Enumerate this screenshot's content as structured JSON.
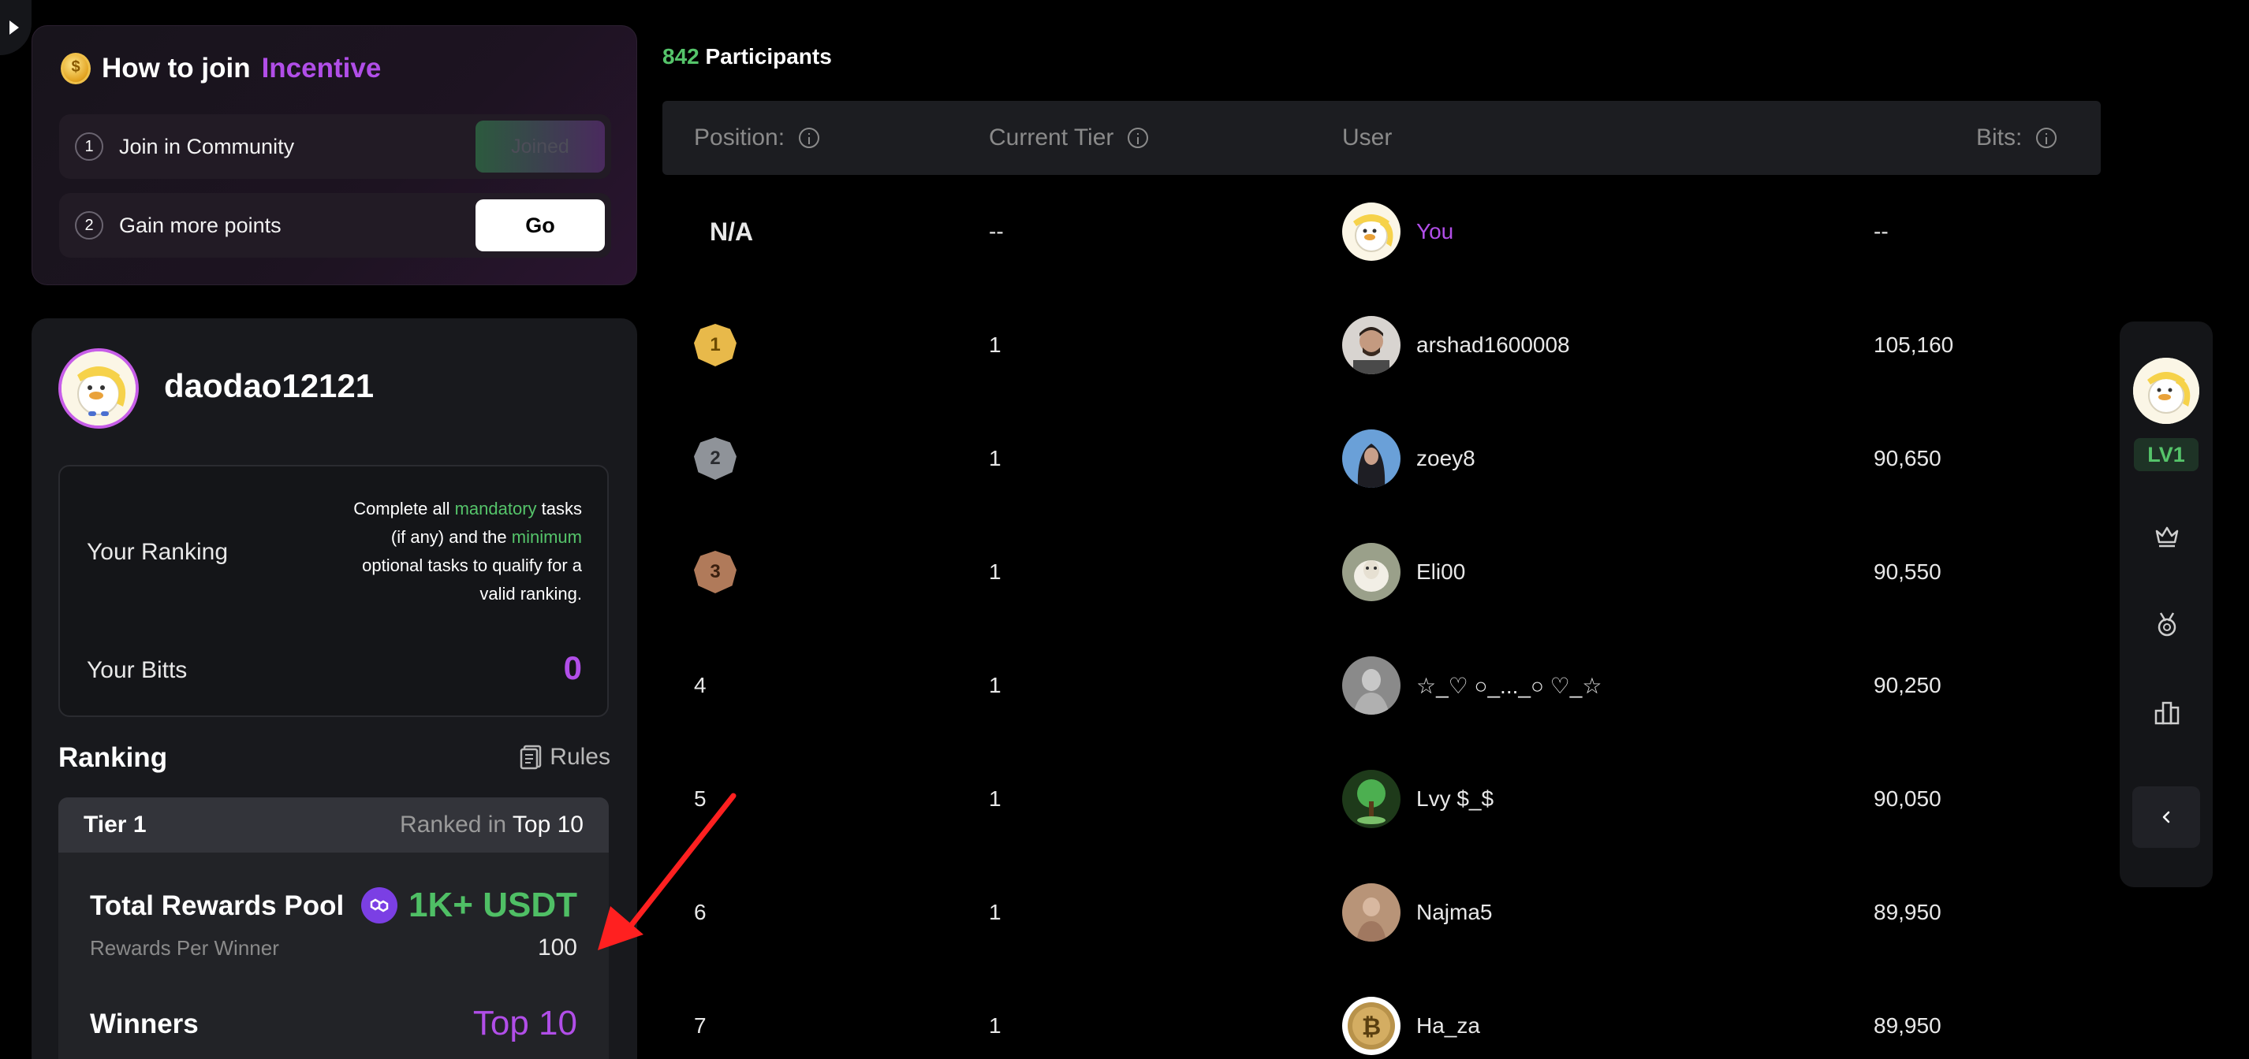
{
  "join": {
    "title_prefix": "How to join",
    "title_accent": "Incentive",
    "steps": [
      {
        "num": "1",
        "label": "Join in Community",
        "button": "Joined"
      },
      {
        "num": "2",
        "label": "Gain more points",
        "button": "Go"
      }
    ]
  },
  "profile": {
    "username": "daodao12121",
    "your_ranking_label": "Your Ranking",
    "note_part1": "Complete all ",
    "note_mandatory": "mandatory",
    "note_part2": " tasks (if any) and the ",
    "note_minimum": "minimum",
    "note_part3": " optional tasks to qualify for a valid ranking.",
    "your_bitts_label": "Your Bitts",
    "your_bitts_value": "0",
    "ranking_title": "Ranking",
    "rules_label": "Rules"
  },
  "tier": {
    "name": "Tier 1",
    "ranked_in_label": "Ranked in",
    "ranked_in_value": "Top 10",
    "pool_label": "Total Rewards Pool",
    "pool_value": "1K+ USDT",
    "per_winner_label": "Rewards Per Winner",
    "per_winner_value": "100",
    "winners_label": "Winners",
    "winners_value": "Top 10"
  },
  "leaderboard": {
    "participants_count": "842",
    "participants_label": "Participants",
    "headers": {
      "position": "Position:",
      "tier": "Current Tier",
      "user": "User",
      "bits": "Bits:"
    },
    "you_row": {
      "position": "N/A",
      "tier": "--",
      "user": "You",
      "bits": "--"
    },
    "rows": [
      {
        "position": "1",
        "tier": "1",
        "user": "arshad1600008",
        "bits": "105,160"
      },
      {
        "position": "2",
        "tier": "1",
        "user": "zoey8",
        "bits": "90,650"
      },
      {
        "position": "3",
        "tier": "1",
        "user": "Eli00",
        "bits": "90,550"
      },
      {
        "position": "4",
        "tier": "1",
        "user": "☆_♡ ○_..._○ ♡_☆",
        "bits": "90,250"
      },
      {
        "position": "5",
        "tier": "1",
        "user": "Lvy $_$",
        "bits": "90,050"
      },
      {
        "position": "6",
        "tier": "1",
        "user": "Najma5",
        "bits": "89,950"
      },
      {
        "position": "7",
        "tier": "1",
        "user": "Ha_za",
        "bits": "89,950"
      }
    ]
  },
  "rail": {
    "level": "LV1",
    "icons": [
      "crown-icon",
      "medal-icon",
      "leaderboard-icon",
      "chevron-left-icon"
    ]
  },
  "colors": {
    "accent_purple": "#b14ee8",
    "accent_green": "#55c46a",
    "background": "#000000",
    "panel": "#18191d"
  }
}
